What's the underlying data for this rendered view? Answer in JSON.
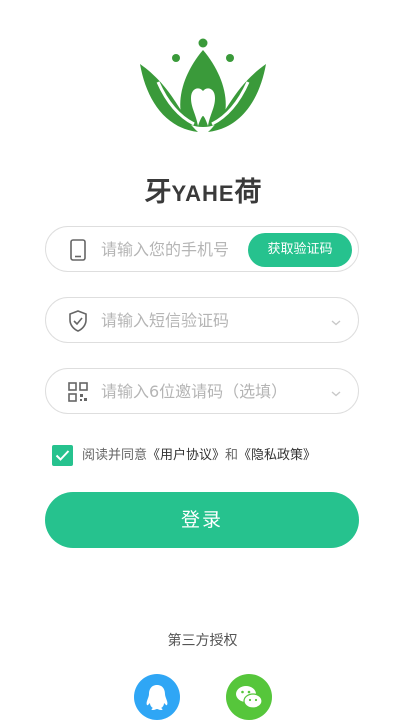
{
  "brand": {
    "left_char": "牙",
    "en": "YAHE",
    "right_char": "荷"
  },
  "phone": {
    "placeholder": "请输入您的手机号",
    "get_code_label": "获取验证码"
  },
  "sms": {
    "placeholder": "请输入短信验证码"
  },
  "invite": {
    "placeholder": "请输入6位邀请码（选填）"
  },
  "agreement": {
    "checked": true,
    "prefix": "阅读并同意",
    "user_agreement": "《用户协议》",
    "and": "和",
    "privacy_policy": "《隐私政策》"
  },
  "login_label": "登录",
  "third_party": {
    "title": "第三方授权"
  },
  "colors": {
    "accent": "#26c28e",
    "logo_green": "#3a9a3a",
    "qq_blue": "#2fa6f5",
    "wechat_green": "#56c63b"
  },
  "icons": [
    "phone-icon",
    "shield-check-icon",
    "qr-code-icon",
    "chevron-down-icon",
    "checkmark-icon",
    "qq-icon",
    "wechat-icon"
  ]
}
